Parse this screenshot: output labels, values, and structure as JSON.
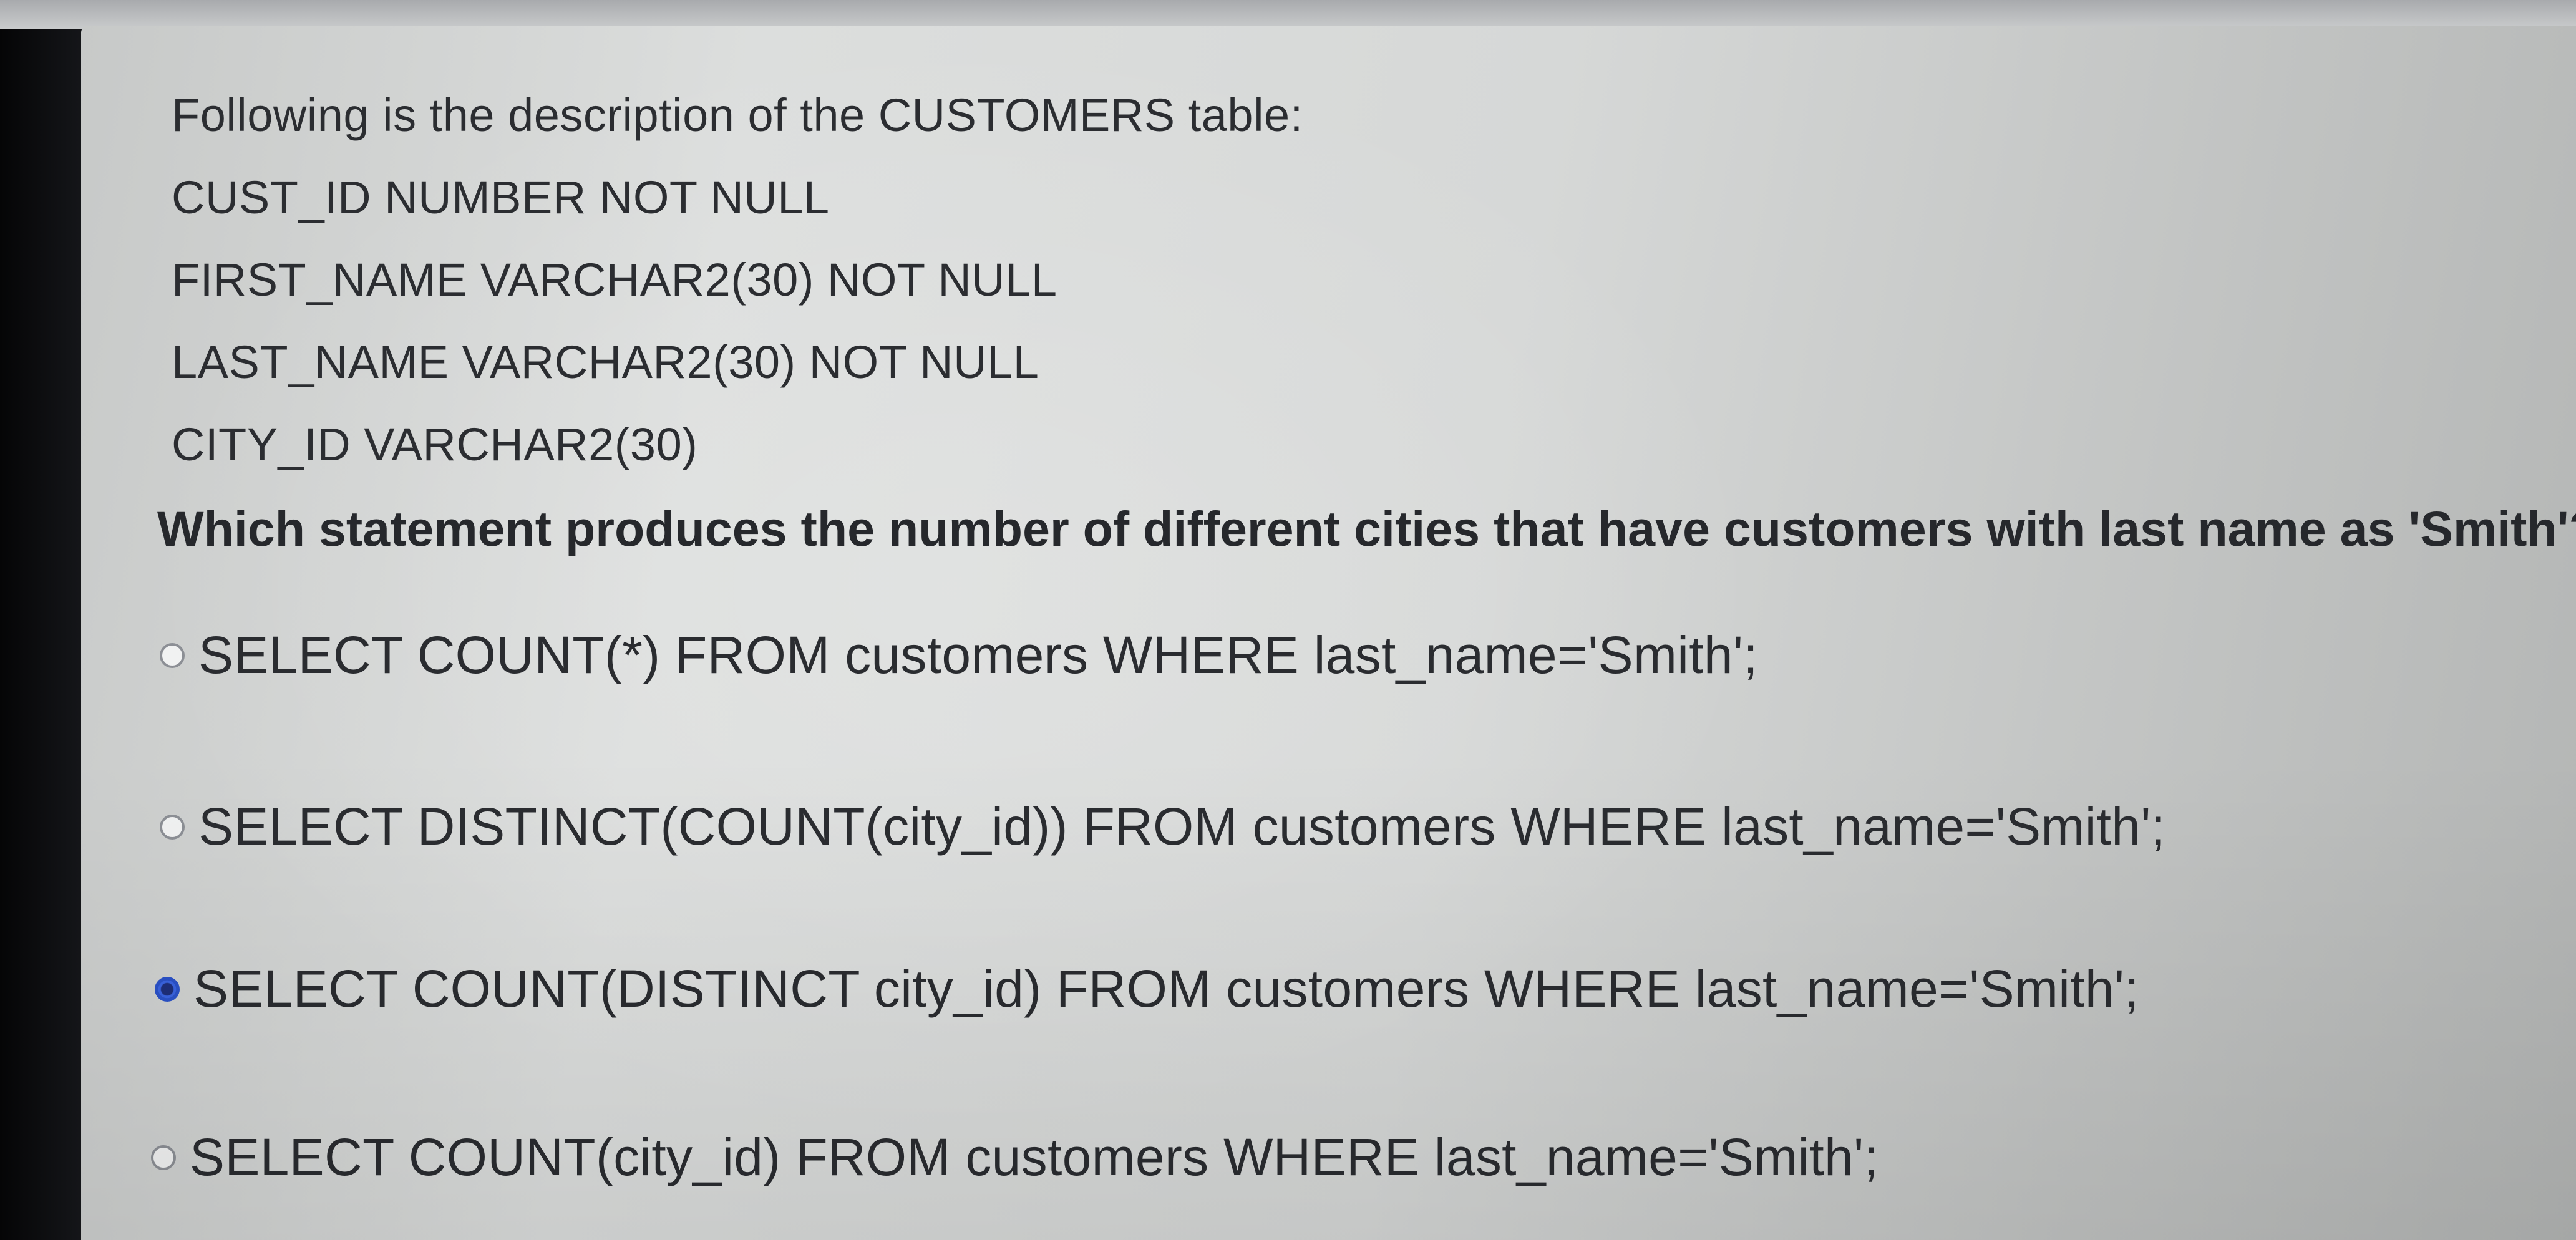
{
  "question": {
    "intro": "Following is the description of the CUSTOMERS table:",
    "columns": [
      "CUST_ID NUMBER NOT NULL",
      "FIRST_NAME VARCHAR2(30) NOT NULL",
      "LAST_NAME VARCHAR2(30) NOT NULL",
      "CITY_ID VARCHAR2(30)"
    ],
    "prompt": "Which statement produces the number of different cities that have customers with last name as 'Smith'?"
  },
  "options": [
    {
      "label": "SELECT COUNT(*) FROM customers WHERE last_name='Smith';",
      "selected": false
    },
    {
      "label": "SELECT DISTINCT(COUNT(city_id)) FROM customers WHERE last_name='Smith';",
      "selected": false
    },
    {
      "label": "SELECT COUNT(DISTINCT city_id) FROM customers WHERE last_name='Smith';",
      "selected": true
    },
    {
      "label": "SELECT COUNT(city_id) FROM customers WHERE last_name='Smith';",
      "selected": false
    }
  ],
  "colors": {
    "text": "#2b2d31",
    "radio_selected": "#2b52c8",
    "screen_background": "#d6d8d7"
  }
}
